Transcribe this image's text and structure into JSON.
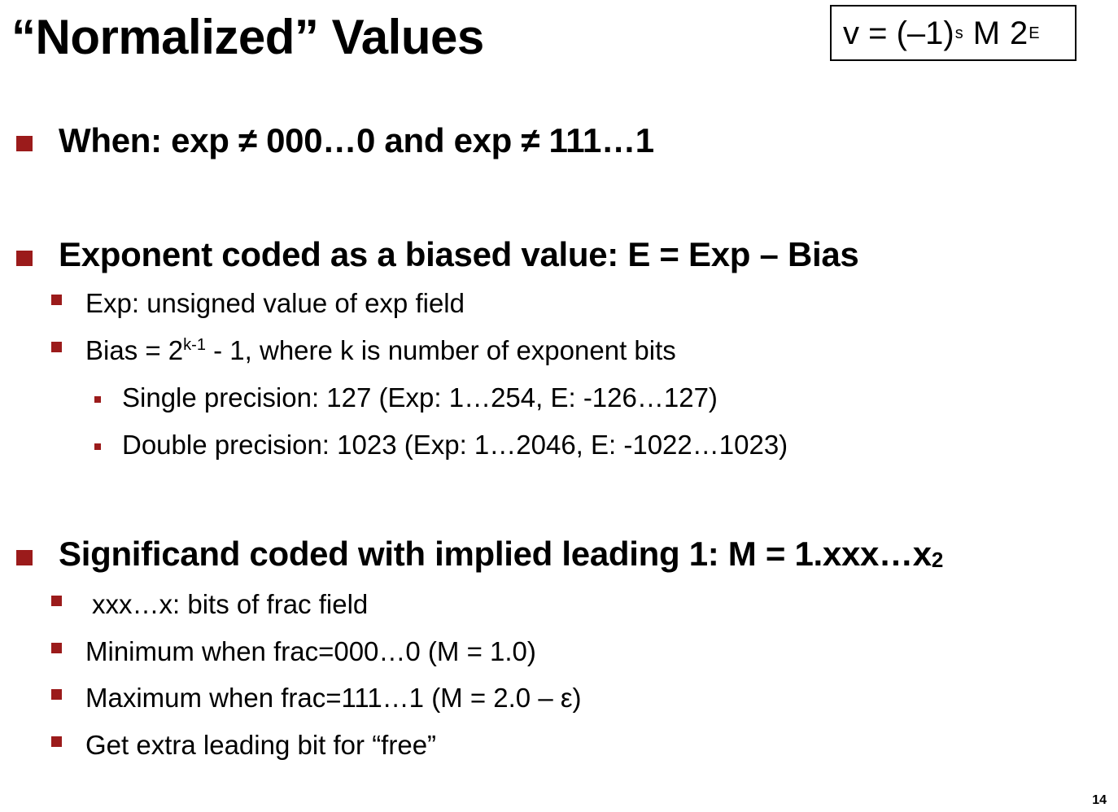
{
  "slide": {
    "title": "“Normalized” Values",
    "page_number": "14",
    "bullet_color": "#9b1b1b"
  },
  "formula": {
    "lhs": "v = (–1)",
    "s_exp": "s",
    "mid": "M",
    "base": "2",
    "e_exp": "E"
  },
  "bullets": {
    "when": "When: exp ≠ 000…0 and exp ≠ 111…1",
    "exponent": {
      "heading": "Exponent coded as a biased value: E  =  Exp – Bias",
      "exp_def": "Exp: unsigned value of exp field",
      "bias_prefix": "Bias = 2",
      "bias_sup": "k-1",
      "bias_suffix": " - 1, where k is number of exponent bits",
      "single": "Single precision: 127 (Exp: 1…254, E: -126…127)",
      "double": "Double precision: 1023 (Exp: 1…2046, E: -1022…1023)"
    },
    "significand": {
      "heading": "Significand coded with implied leading 1: M  =  1.xxx…x",
      "heading_sub": "2",
      "xxx": "xxx…x: bits of frac field",
      "min": "Minimum when frac=000…0 (M = 1.0)",
      "max": "Maximum when frac=111…1 (M = 2.0 – ε)",
      "extra": "Get extra leading bit for “free”"
    }
  }
}
